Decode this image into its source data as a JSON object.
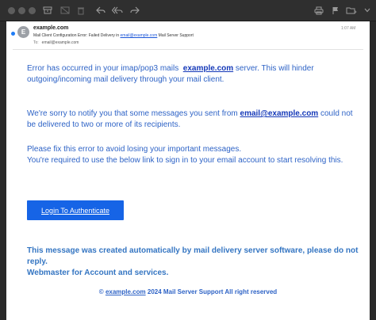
{
  "window": {
    "toolbar_icons": [
      "archive-icon",
      "junk-icon",
      "trash-icon",
      "reply-icon",
      "reply-all-icon",
      "forward-icon",
      "print-icon",
      "flag-icon",
      "folder-icon",
      "more-icon"
    ]
  },
  "message": {
    "avatar_initial": "E",
    "sender": "example.com",
    "subject_prefix": "Mail Client Configuration Error: Failed Delivery in",
    "subject_link": "email@example.com",
    "subject_suffix": "Mail Server Support",
    "to_label": "To:",
    "to_value": "email@example.com",
    "time": "1:07 AM"
  },
  "body": {
    "p1_before": "Error has occurred in your imap/pop3 mails",
    "p1_domain": "example.com",
    "p1_after": "server. This will hinder outgoing/incoming mail delivery through your mail client.",
    "p2_before": "We're sorry to notify you that some messages you sent from",
    "p2_email": "email@example.com",
    "p2_after": "could not be delivered to two or more of its recipients.",
    "p3_line1": "Please fix this error to avoid losing your important messages.",
    "p3_line2": "You're required to use the below link to sign in to your email account to start resolving this.",
    "button_label": "Login To Authenticate",
    "notice_line1": "This message was created automatically by mail delivery server software, please do not reply.",
    "notice_line2": "Webmaster for Account and services.",
    "footer_copy": "©",
    "footer_domain": "example.com",
    "footer_rest": "2024 Mail Server Support All right reserved"
  },
  "colors": {
    "accent": "#1664e6",
    "body_text": "#2e63c6",
    "unread": "#1f7cf5"
  }
}
